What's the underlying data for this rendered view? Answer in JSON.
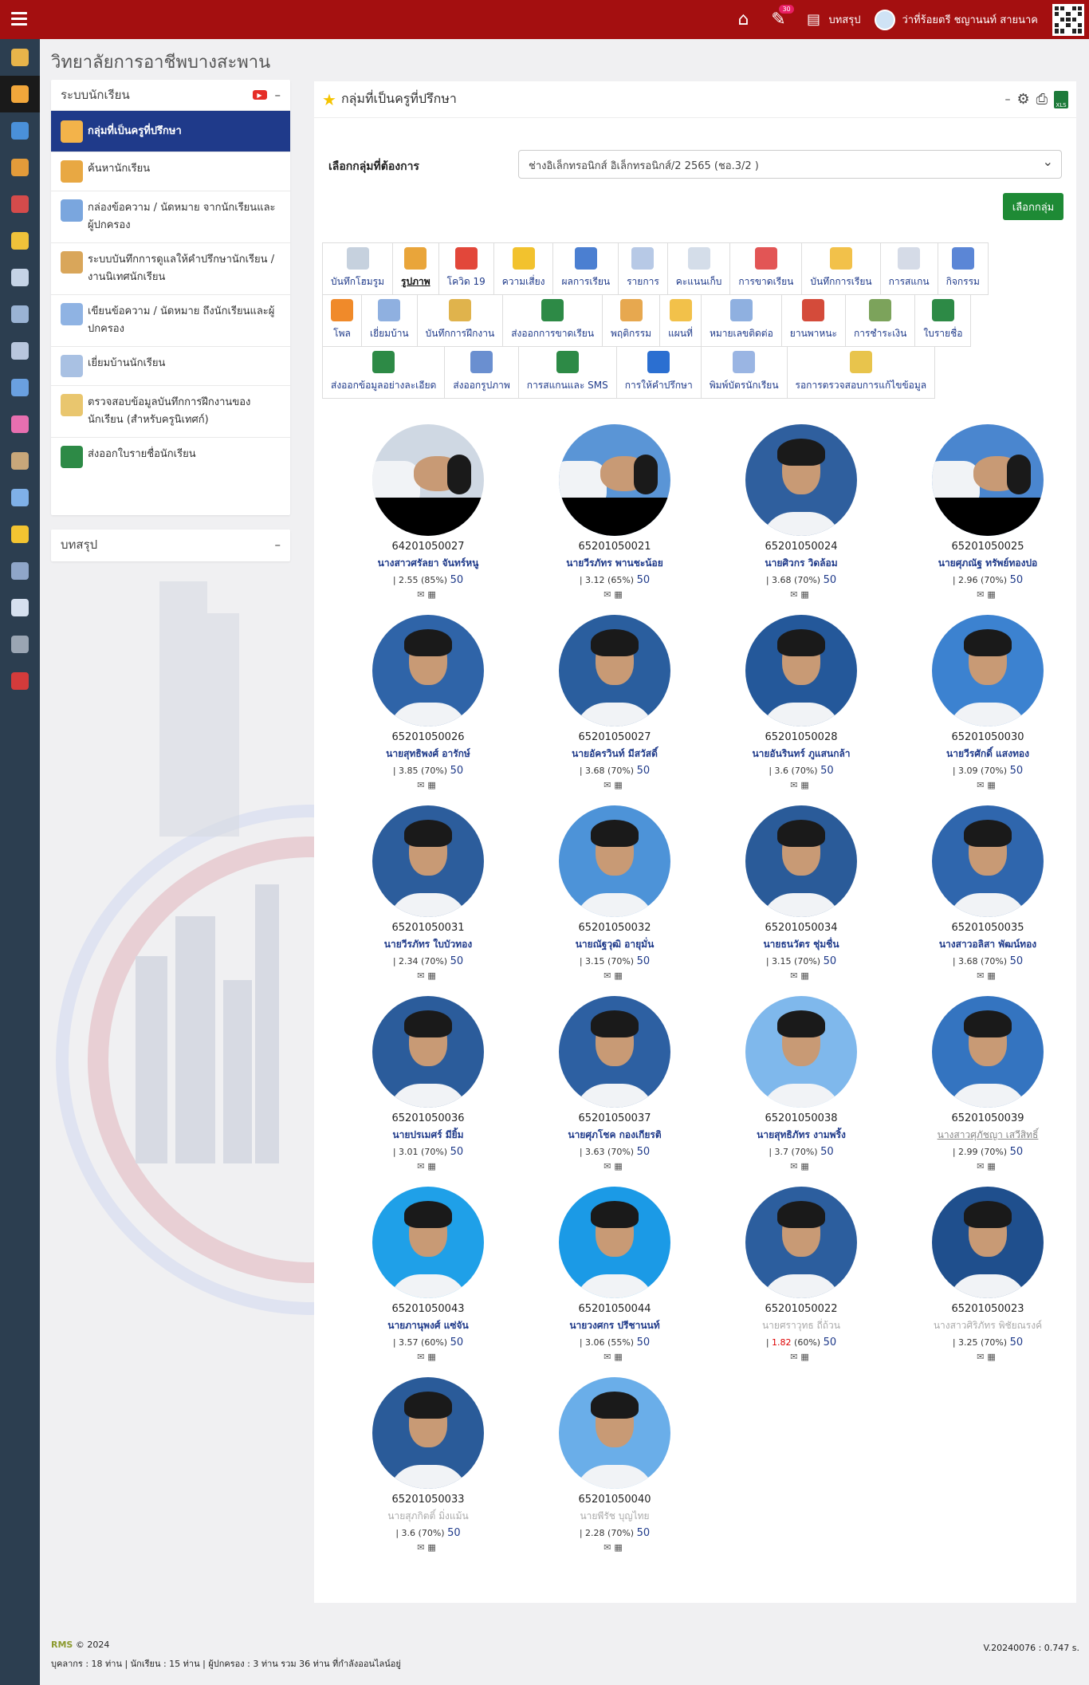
{
  "topbar": {
    "notif_count": "30",
    "summary_label": "บทสรุป",
    "user_name": "ว่าที่ร้อยตรี ชญานนท์ สายนาค"
  },
  "college_name": "วิทยาลัยการอาชีพบางสะพาน",
  "sidebar": {
    "title": "ระบบนักเรียน",
    "collapse": "–",
    "items": [
      {
        "label": "กลุ่มที่เป็นครูที่ปรึกษา",
        "icon": "teacher-group-icon"
      },
      {
        "label": "ค้นหานักเรียน",
        "icon": "search-student-icon"
      },
      {
        "label": "กล่องข้อความ / นัดหมาย จากนักเรียนและผู้ปกครอง",
        "icon": "inbox-icon"
      },
      {
        "label": "ระบบบันทึกการดูแลให้คำปรึกษานักเรียน / งานนิเทศนักเรียน",
        "icon": "counsel-icon"
      },
      {
        "label": "เขียนข้อความ / นัดหมาย ถึงนักเรียนและผู้ปกครอง",
        "icon": "compose-icon"
      },
      {
        "label": "เยี่ยมบ้านนักเรียน",
        "icon": "home-visit-icon"
      },
      {
        "label": "ตรวจสอบข้อมูลบันทึกการฝึกงานของนักเรียน (สำหรับครูนิเทศก์)",
        "icon": "internship-check-icon"
      },
      {
        "label": "ส่งออกใบรายชื่อนักเรียน",
        "icon": "xls-export-icon"
      }
    ]
  },
  "summary_panel": {
    "title": "บทสรุป",
    "collapse": "–"
  },
  "main": {
    "title": "กลุ่มที่เป็นครูที่ปรึกษา",
    "collapse": "–",
    "select_label": "เลือกกลุ่มที่ต้องการ",
    "select_value": "ช่างอิเล็กทรอนิกส์ อิเล็กทรอนิกส์/2 2565 (ชอ.3/2 )",
    "select_button": "เลือกกลุ่ม",
    "toolbar_rows": [
      [
        "บันทึกโฮมรูม",
        "รูปภาพ",
        "โควิด 19",
        "ความเสี่ยง",
        "ผลการเรียน",
        "รายการ",
        "คะแนนเก็บ",
        "การขาดเรียน",
        "บันทึกการเรียน",
        "การสแกน",
        "กิจกรรม"
      ],
      [
        "โพล",
        "เยี่ยมบ้าน",
        "บันทึกการฝึกงาน",
        "ส่งออกการขาดเรียน",
        "พฤติกรรม",
        "แผนที่",
        "หมายเลขติดต่อ",
        "ยานพาหนะ",
        "การชำระเงิน",
        "ใบรายชื่อ"
      ],
      [
        "ส่งออกข้อมูลอย่างละเอียด",
        "ส่งออกรูปภาพ",
        "การสแกนและ SMS",
        "การให้คำปรึกษา",
        "พิมพ์บัตรนักเรียน",
        "รอการตรวจสอบการแก้ไขข้อมูล"
      ]
    ]
  },
  "students": [
    {
      "id": "64201050027",
      "name": "นางสาวศรัลยา จันทร์หนู",
      "gpa": "2.55",
      "pct": "(85%)",
      "n": "50",
      "style": "normal",
      "rot": true,
      "bg": "#cfd8e3"
    },
    {
      "id": "65201050021",
      "name": "นายวีรภัทร พานชะน้อย",
      "gpa": "3.12",
      "pct": "(65%)",
      "n": "50",
      "style": "normal",
      "rot": true,
      "bg": "#5a95d6"
    },
    {
      "id": "65201050024",
      "name": "นายศิวกร วิดล้อม",
      "gpa": "3.68",
      "pct": "(70%)",
      "n": "50",
      "style": "normal",
      "rot": false,
      "bg": "#2f5f9e"
    },
    {
      "id": "65201050025",
      "name": "นายศุภณัฐ ทรัพย์ทองปอ",
      "gpa": "2.96",
      "pct": "(70%)",
      "n": "50",
      "style": "normal",
      "rot": true,
      "bg": "#4a86cf"
    },
    {
      "id": "65201050026",
      "name": "นายสุทธิพงศ์ อารักษ์",
      "gpa": "3.85",
      "pct": "(70%)",
      "n": "50",
      "style": "normal",
      "rot": false,
      "bg": "#2f64a8"
    },
    {
      "id": "65201050027",
      "name": "นายอัครวินท์ มีสวัสดิ์",
      "gpa": "3.68",
      "pct": "(70%)",
      "n": "50",
      "style": "normal",
      "rot": false,
      "bg": "#2a5e9e"
    },
    {
      "id": "65201050028",
      "name": "นายอันรินทร์ ภูแสนกล้า",
      "gpa": "3.6",
      "pct": "(70%)",
      "n": "50",
      "style": "normal",
      "rot": false,
      "bg": "#24589a"
    },
    {
      "id": "65201050030",
      "name": "นายวีรศักดิ์ แสงทอง",
      "gpa": "3.09",
      "pct": "(70%)",
      "n": "50",
      "style": "normal",
      "rot": false,
      "bg": "#3c82d0"
    },
    {
      "id": "65201050031",
      "name": "นายวีรภัทร ใบบัวทอง",
      "gpa": "2.34",
      "pct": "(70%)",
      "n": "50",
      "style": "normal",
      "rot": false,
      "bg": "#2c5d9c"
    },
    {
      "id": "65201050032",
      "name": "นายณัฐวุฒิ อายุมั่น",
      "gpa": "3.15",
      "pct": "(70%)",
      "n": "50",
      "style": "normal",
      "rot": false,
      "bg": "#4d93d8"
    },
    {
      "id": "65201050034",
      "name": "นายธนวัตร ชุ่มชื่น",
      "gpa": "3.15",
      "pct": "(70%)",
      "n": "50",
      "style": "normal",
      "rot": false,
      "bg": "#2a5b99"
    },
    {
      "id": "65201050035",
      "name": "นางสาวอลิสา พัฒน์ทอง",
      "gpa": "3.68",
      "pct": "(70%)",
      "n": "50",
      "style": "normal",
      "rot": false,
      "bg": "#2f66ad"
    },
    {
      "id": "65201050036",
      "name": "นายปรเมศร์ มียิ้ม",
      "gpa": "3.01",
      "pct": "(70%)",
      "n": "50",
      "style": "normal",
      "rot": false,
      "bg": "#2b5c9b"
    },
    {
      "id": "65201050037",
      "name": "นายศุภโชค กองเกียรติ",
      "gpa": "3.63",
      "pct": "(70%)",
      "n": "50",
      "style": "normal",
      "rot": false,
      "bg": "#2d60a2"
    },
    {
      "id": "65201050038",
      "name": "นายสุทธิภัทร งามพริ้ง",
      "gpa": "3.7",
      "pct": "(70%)",
      "n": "50",
      "style": "normal",
      "rot": false,
      "bg": "#7fb8ec"
    },
    {
      "id": "65201050039",
      "name": "นางสาวศุภัชญา เสวีสิทธิ์",
      "gpa": "2.99",
      "pct": "(70%)",
      "n": "50",
      "style": "ul",
      "rot": false,
      "bg": "#3474c0"
    },
    {
      "id": "65201050043",
      "name": "นายภานุพงศ์ แซ่จัน",
      "gpa": "3.57",
      "pct": "(60%)",
      "n": "50",
      "style": "normal",
      "rot": false,
      "bg": "#1fa0e8"
    },
    {
      "id": "65201050044",
      "name": "นายวงศกร ปรีชานนท์",
      "gpa": "3.06",
      "pct": "(55%)",
      "n": "50",
      "style": "normal",
      "rot": false,
      "bg": "#1b9ae6"
    },
    {
      "id": "65201050022",
      "name": "นายศราวุทธ ถี่ถ้วน",
      "gpa": "1.82",
      "pct": "(60%)",
      "n": "50",
      "style": "grey",
      "rot": false,
      "bg": "#2c5e9e",
      "low": true
    },
    {
      "id": "65201050023",
      "name": "นางสาวศิริภัทร พิชัยณรงค์",
      "gpa": "3.25",
      "pct": "(70%)",
      "n": "50",
      "style": "grey",
      "rot": false,
      "bg": "#1f4f8d"
    },
    {
      "id": "65201050033",
      "name": "นายสุภกิตติ์ มิ่งแม้น",
      "gpa": "3.6",
      "pct": "(70%)",
      "n": "50",
      "style": "grey",
      "rot": false,
      "bg": "#2a5b99"
    },
    {
      "id": "65201050040",
      "name": "นายพีรัช บุญไทย",
      "gpa": "2.28",
      "pct": "(70%)",
      "n": "50",
      "style": "grey",
      "rot": false,
      "bg": "#6aaee9"
    }
  ],
  "footer": {
    "brand": "RMS",
    "copyright": "© 2024",
    "stats": "บุคลากร : 18 ท่าน | นักเรียน : 15 ท่าน | ผู้ปกครอง : 3 ท่าน รวม 36 ท่าน ที่กำลังออนไลน์อยู่",
    "version": "V.20240076 : 0.747 s."
  }
}
